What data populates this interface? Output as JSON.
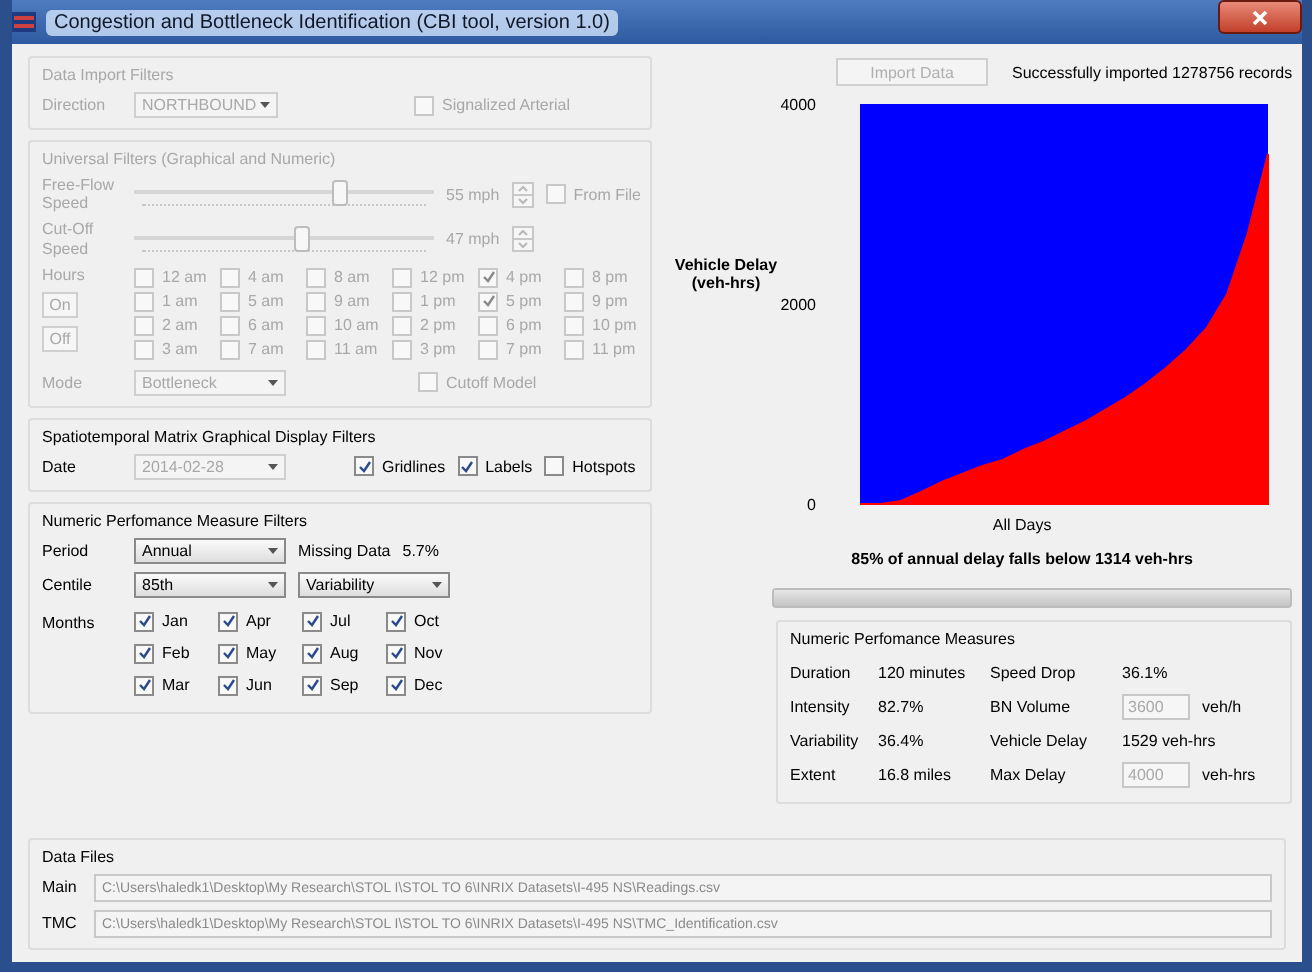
{
  "window": {
    "title": "Congestion and Bottleneck Identification (CBI tool, version 1.0)"
  },
  "import_filters": {
    "title": "Data Import Filters",
    "disabled": true,
    "direction_label": "Direction",
    "direction_value": "NORTHBOUND",
    "signalized": {
      "label": "Signalized Arterial",
      "checked": false
    }
  },
  "universal_filters": {
    "title": "Universal Filters (Graphical and Numeric)",
    "disabled": true,
    "sliders": [
      {
        "label": "Free-Flow Speed",
        "level": 0.68,
        "reading": "55 mph",
        "from_file": {
          "label": "From File",
          "checked": false
        }
      },
      {
        "label": "Cut-Off Speed",
        "level": 0.55,
        "reading": "47 mph"
      }
    ],
    "hours_label": "Hours",
    "on_button": "On",
    "off_button": "Off",
    "hours": [
      {
        "label": "12 am",
        "checked": false
      },
      {
        "label": "1 am",
        "checked": false
      },
      {
        "label": "2 am",
        "checked": false
      },
      {
        "label": "3 am",
        "checked": false
      },
      {
        "label": "4 am",
        "checked": false
      },
      {
        "label": "5 am",
        "checked": false
      },
      {
        "label": "6 am",
        "checked": false
      },
      {
        "label": "7 am",
        "checked": false
      },
      {
        "label": "8 am",
        "checked": false
      },
      {
        "label": "9 am",
        "checked": false
      },
      {
        "label": "10 am",
        "checked": false
      },
      {
        "label": "11 am",
        "checked": false
      },
      {
        "label": "12 pm",
        "checked": false
      },
      {
        "label": "1 pm",
        "checked": false
      },
      {
        "label": "2 pm",
        "checked": false
      },
      {
        "label": "3 pm",
        "checked": false
      },
      {
        "label": "4 pm",
        "checked": true
      },
      {
        "label": "5 pm",
        "checked": true
      },
      {
        "label": "6 pm",
        "checked": false
      },
      {
        "label": "7 pm",
        "checked": false
      },
      {
        "label": "8 pm",
        "checked": false
      },
      {
        "label": "9 pm",
        "checked": false
      },
      {
        "label": "10 pm",
        "checked": false
      },
      {
        "label": "11 pm",
        "checked": false
      }
    ],
    "mode_label": "Mode",
    "mode_value": "Bottleneck",
    "cutoff_model": {
      "label": "Cutoff Model",
      "checked": false
    }
  },
  "display_filters": {
    "title": "Spatiotemporal Matrix Graphical Display Filters",
    "date_label": "Date",
    "date_value": "2014-02-28",
    "options": [
      {
        "label": "Gridlines",
        "checked": true
      },
      {
        "label": "Labels",
        "checked": true
      },
      {
        "label": "Hotspots",
        "checked": false
      }
    ]
  },
  "numeric_filters": {
    "title": "Numeric Perfomance Measure Filters",
    "period_label": "Period",
    "period_value": "Annual",
    "missing_label": "Missing Data",
    "missing_value": "5.7%",
    "centile_label": "Centile",
    "centile_value": "85th",
    "measure_value": "Variability",
    "months_label": "Months",
    "months": [
      {
        "label": "Jan",
        "checked": true
      },
      {
        "label": "Feb",
        "checked": true
      },
      {
        "label": "Mar",
        "checked": true
      },
      {
        "label": "Apr",
        "checked": true
      },
      {
        "label": "May",
        "checked": true
      },
      {
        "label": "Jun",
        "checked": true
      },
      {
        "label": "Jul",
        "checked": true
      },
      {
        "label": "Aug",
        "checked": true
      },
      {
        "label": "Sep",
        "checked": true
      },
      {
        "label": "Oct",
        "checked": true
      },
      {
        "label": "Nov",
        "checked": true
      },
      {
        "label": "Dec",
        "checked": true
      }
    ]
  },
  "import": {
    "button": "Import Data",
    "button_disabled": true,
    "status": "Successfully imported 1278756 records"
  },
  "chart": {
    "chart_data": {
      "type": "area",
      "xlabel": "All Days",
      "ylabel": "Vehicle Delay (veh-hrs)",
      "ylim": [
        0,
        4000
      ],
      "yticks": [
        0,
        2000,
        4000
      ],
      "series": [
        {
          "color": "#ff0000",
          "values": [
            0,
            0,
            30,
            120,
            220,
            300,
            380,
            440,
            540,
            620,
            720,
            820,
            940,
            1060,
            1200,
            1360,
            1540,
            1760,
            2100,
            2700,
            3500
          ]
        }
      ]
    },
    "caption": "85% of annual delay falls below 1314 veh-hrs",
    "progress": {
      "level": 1
    }
  },
  "measures": {
    "title": "Numeric Perfomance Measures",
    "rows": [
      {
        "label": "Duration",
        "value": "120 minutes",
        "label2": "Speed Drop",
        "kind": "text",
        "value2": "36.1%"
      },
      {
        "label": "Intensity",
        "value": "82.7%",
        "label2": "BN Volume",
        "kind": "field",
        "value2": "3600",
        "unit": "veh/h"
      },
      {
        "label": "Variability",
        "value": "36.4%",
        "label2": "Vehicle Delay",
        "kind": "text",
        "value2": "1529 veh-hrs"
      },
      {
        "label": "Extent",
        "value": "16.8 miles",
        "label2": "Max Delay",
        "kind": "field",
        "value2": "4000",
        "unit": "veh-hrs"
      }
    ]
  },
  "data_files": {
    "title": "Data Files",
    "files": [
      {
        "label": "Main",
        "path": "C:\\Users\\haledk1\\Desktop\\My Research\\STOL I\\STOL TO 6\\INRIX Datasets\\I-495 NS\\Readings.csv"
      },
      {
        "label": "TMC",
        "path": "C:\\Users\\haledk1\\Desktop\\My Research\\STOL I\\STOL TO 6\\INRIX Datasets\\I-495 NS\\TMC_Identification.csv"
      }
    ]
  }
}
